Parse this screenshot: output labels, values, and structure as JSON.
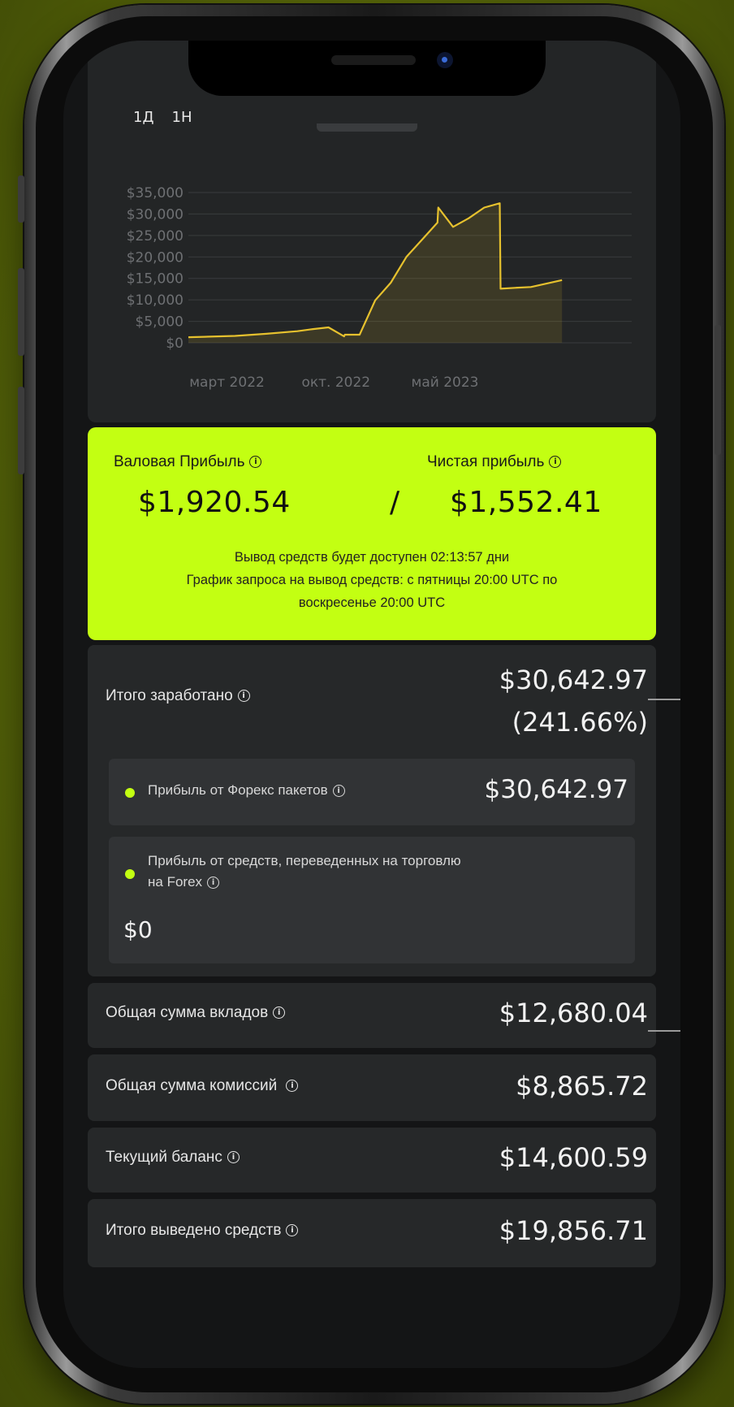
{
  "colors": {
    "accent": "#c3ff12",
    "chart_line": "#e6c12e",
    "background": "#141516",
    "card": "#262829"
  },
  "periods": [
    "1Д",
    "1Н"
  ],
  "chart_data": {
    "type": "area",
    "title": "",
    "xlabel": "",
    "ylabel": "",
    "y_tick_labels": [
      "$35,000",
      "$30,000",
      "$25,000",
      "$20,000",
      "$15,000",
      "$10,000",
      "$5,000",
      "$0"
    ],
    "ylim": [
      0,
      35000
    ],
    "x_tick_labels": [
      "март 2022",
      "окт. 2022",
      "май 2023"
    ],
    "x": [
      "2021-12",
      "2022-01",
      "2022-03",
      "2022-05",
      "2022-07",
      "2022-08",
      "2022-09",
      "2022-10",
      "2022-10",
      "2022-11",
      "2022-12",
      "2023-01",
      "2023-02",
      "2023-03",
      "2023-04",
      "2023-04",
      "2023-05",
      "2023-06",
      "2023-07",
      "2023-08",
      "2023-08",
      "2023-09",
      "2023-10",
      "2023-11",
      "2023-12"
    ],
    "values": [
      1300,
      1400,
      1600,
      2100,
      2700,
      3200,
      3600,
      1500,
      1900,
      1900,
      9900,
      14000,
      20000,
      24000,
      28000,
      31500,
      27000,
      29000,
      31500,
      32500,
      12600,
      12800,
      13000,
      13800,
      14600
    ],
    "grid": true,
    "legend": "none"
  },
  "summary": {
    "gross_label": "Валовая Прибыль",
    "gross_value": "$1,920.54",
    "separator": "/",
    "net_label": "Чистая прибыль",
    "net_value": "$1,552.41",
    "withdraw_line1": "Вывод средств будет доступен 02:13:57 дни",
    "withdraw_line2": "График запроса на вывод средств: с пятницы 20:00 UTC по",
    "withdraw_line3": "воскресенье 20:00 UTC"
  },
  "earned": {
    "label": "Итого заработано",
    "value": "$30,642.97",
    "percent": "(241.66%)",
    "forex_label": "Прибыль от Форекс пакетов",
    "forex_value": "$30,642.97",
    "transfer_label_line1": "Прибыль от средств, переведенных на торговлю",
    "transfer_label_line2": "на Forex",
    "transfer_value": "$0"
  },
  "rows": [
    {
      "label": "Общая сумма вкладов",
      "value": "$12,680.04"
    },
    {
      "label": "Общая сумма комиссий",
      "value": "$8,865.72"
    },
    {
      "label": "Текущий баланс",
      "value": "$14,600.59"
    },
    {
      "label": "Итого выведено средств",
      "value": "$19,856.71"
    }
  ],
  "info_glyph": "i"
}
